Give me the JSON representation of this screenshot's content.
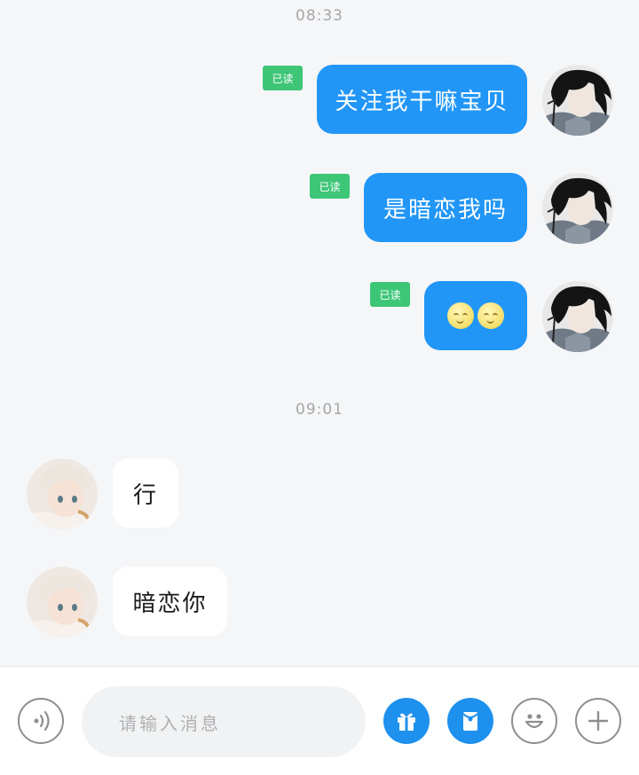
{
  "conversation": {
    "time_1": "08:33",
    "time_2": "09:01",
    "read_label": "已读",
    "sent": [
      {
        "text": "关注我干嘛宝贝"
      },
      {
        "text": "是暗恋我吗"
      },
      {
        "emoji": [
          "slightly-smiling-moon-face",
          "slightly-smiling-moon-face"
        ]
      }
    ],
    "received": [
      {
        "text": "行"
      },
      {
        "text": "暗恋你"
      }
    ]
  },
  "composer": {
    "placeholder": "请输入消息",
    "buttons": [
      "voice-icon",
      "gift-icon",
      "red-envelope-icon",
      "emoji-icon",
      "plus-icon"
    ]
  },
  "colors": {
    "outgoing_bubble": "#2196f7",
    "incoming_bubble": "#ffffff",
    "read_badge": "#3ec677",
    "background": "#f5f6f8",
    "accent_button": "#1e90ee"
  }
}
